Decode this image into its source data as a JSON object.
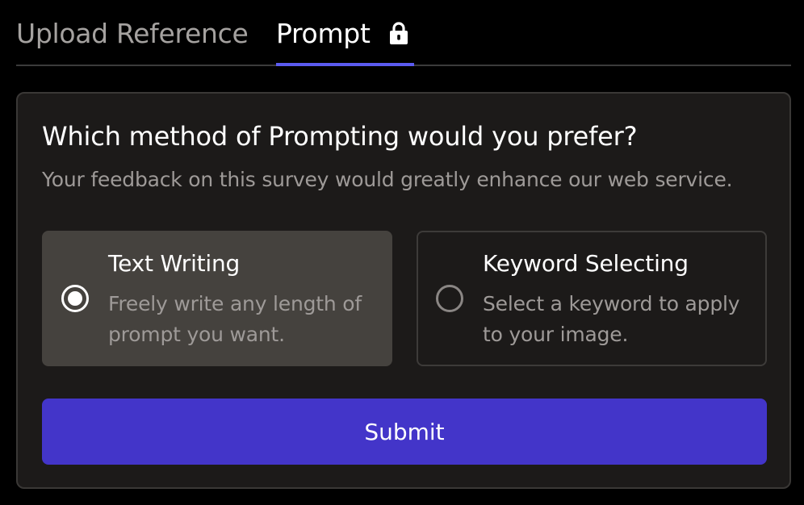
{
  "tabs": {
    "upload_label": "Upload Reference",
    "prompt_label": "Prompt",
    "active": "Prompt",
    "prompt_icon": "lock-icon"
  },
  "survey": {
    "question": "Which method of Prompting would you prefer?",
    "subtitle": "Your feedback on this survey would greatly enhance our web service.",
    "options": [
      {
        "title": "Text Writing",
        "description": "Freely write any length of prompt you want.",
        "selected": true
      },
      {
        "title": "Keyword Selecting",
        "description": "Select a keyword to apply to your image.",
        "selected": false
      }
    ],
    "submit_label": "Submit"
  },
  "colors": {
    "background": "#000000",
    "card": "#1c1a19",
    "selected_option": "#45423e",
    "accent": "#5b5bf0",
    "submit": "#4335c9"
  }
}
